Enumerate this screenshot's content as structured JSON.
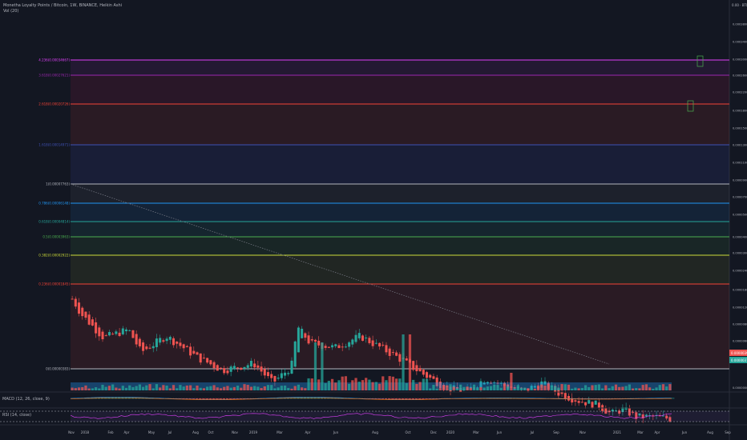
{
  "header": {
    "title": "Monetha Loyalty Points / Bitcoin, 1W, BINANCE, Heikin Ashi",
    "vol_label": "Vol (20)"
  },
  "indicators": {
    "macd_label": "MACD (12, 26, close, 9)",
    "rsi_label": "RSI (14, close)"
  },
  "price_axis": {
    "unit_label": "0.00 · BTC · 3/1",
    "ticks": [
      "0.00038000",
      "0.00034000",
      "0.00030000",
      "0.00026000",
      "0.00022000",
      "0.00018000",
      "0.00015000",
      "0.00013000",
      "0.00011000",
      "0.00009000",
      "0.00007000",
      "0.00005000",
      "0.00004000",
      "0.00003000",
      "0.00002400",
      "0.00001800",
      "0.00001200",
      "0.00000800",
      "0.00000600",
      "0.00000400"
    ],
    "indicator_tick": "0.00000000",
    "current_price_tag": "0.00000391",
    "current_price_tag2": "0.00000373"
  },
  "time_axis": {
    "labels": [
      "Nov",
      "2018",
      "Feb",
      "Apr",
      "May",
      "Jul",
      "Aug",
      "Oct",
      "Nov",
      "2019",
      "Mar",
      "Apr",
      "Jun",
      "Aug",
      "Oct",
      "Dec",
      "2020",
      "Mar",
      "Jun",
      "Jul",
      "Sep",
      "Nov",
      "2021",
      "Mar",
      "Apr",
      "Jun",
      "Aug",
      "Sep"
    ]
  },
  "fib_levels": [
    {
      "label": "4.236(0.00034667)",
      "color": "#e040fb"
    },
    {
      "label": "3.618(0.00027621)",
      "color": "#9c27b0"
    },
    {
      "label": "2.618(0.00020726)",
      "color": "#f44336"
    },
    {
      "label": "1.618(0.00014971)",
      "color": "#3f51b5"
    },
    {
      "label": "1(0.00007763)",
      "color": "#b2b5be"
    },
    {
      "label": "0.786(0.00006148)",
      "color": "#2196f3"
    },
    {
      "label": "0.618(0.00004814)",
      "color": "#26a69a"
    },
    {
      "label": "0.5(0.00003963)",
      "color": "#4caf50"
    },
    {
      "label": "0.382(0.00002922)",
      "color": "#cddc39"
    },
    {
      "label": "0.236(0.00001845)",
      "color": "#f44336"
    },
    {
      "label": "0(0.00000383)",
      "color": "#b2b5be"
    }
  ],
  "colors": {
    "background": "#131722",
    "up": "#26a69a",
    "down": "#ef5350",
    "trendline": "#787b86"
  },
  "chart_data": {
    "type": "candlestick",
    "title": "Monetha Loyalty Points / Bitcoin, 1W, BINANCE, Heikin Ashi",
    "xlabel": "",
    "ylabel": "",
    "scale": "log",
    "ylim": [
      3e-06,
      0.00052
    ],
    "x_range": [
      "2017-10",
      "2021-09"
    ],
    "ohlc_approx": [
      {
        "date": "2017-10",
        "open": 6e-05,
        "close": 4.2e-05
      },
      {
        "date": "2017-12",
        "open": 4e-05,
        "close": 2.5e-05
      },
      {
        "date": "2018-02",
        "open": 2e-05,
        "close": 2.6e-05
      },
      {
        "date": "2018-04",
        "open": 2.1e-05,
        "close": 1.4e-05
      },
      {
        "date": "2018-06",
        "open": 1.4e-05,
        "close": 1.2e-05
      },
      {
        "date": "2018-08",
        "open": 1.1e-05,
        "close": 9e-06
      },
      {
        "date": "2018-10",
        "open": 9e-06,
        "close": 3.3e-05
      },
      {
        "date": "2018-12",
        "open": 2.5e-05,
        "close": 1.9e-05
      },
      {
        "date": "2019-02",
        "open": 2e-05,
        "close": 2.3e-05
      },
      {
        "date": "2019-04",
        "open": 2.8e-05,
        "close": 1.7e-05
      },
      {
        "date": "2019-06",
        "open": 1.3e-05,
        "close": 9e-06
      },
      {
        "date": "2019-08",
        "open": 7.5e-06,
        "close": 7e-06
      },
      {
        "date": "2019-10",
        "open": 8.5e-06,
        "close": 9e-06
      },
      {
        "date": "2019-12",
        "open": 8.5e-06,
        "close": 7e-06
      },
      {
        "date": "2020-02",
        "open": 9.5e-06,
        "close": 8e-06
      },
      {
        "date": "2020-04",
        "open": 6.5e-06,
        "close": 5.5e-06
      },
      {
        "date": "2020-06",
        "open": 5.8e-06,
        "close": 5.6e-06
      },
      {
        "date": "2020-08",
        "open": 5.5e-06,
        "close": 4.5e-06
      },
      {
        "date": "2020-10",
        "open": 4.5e-06,
        "close": 5e-06
      },
      {
        "date": "2020-12",
        "open": 4e-06,
        "close": 3.8e-06
      },
      {
        "date": "2021-02",
        "open": 3.9e-06,
        "close": 4.1e-06
      },
      {
        "date": "2021-04",
        "open": 4e-06,
        "close": 3.9e-06
      }
    ]
  }
}
